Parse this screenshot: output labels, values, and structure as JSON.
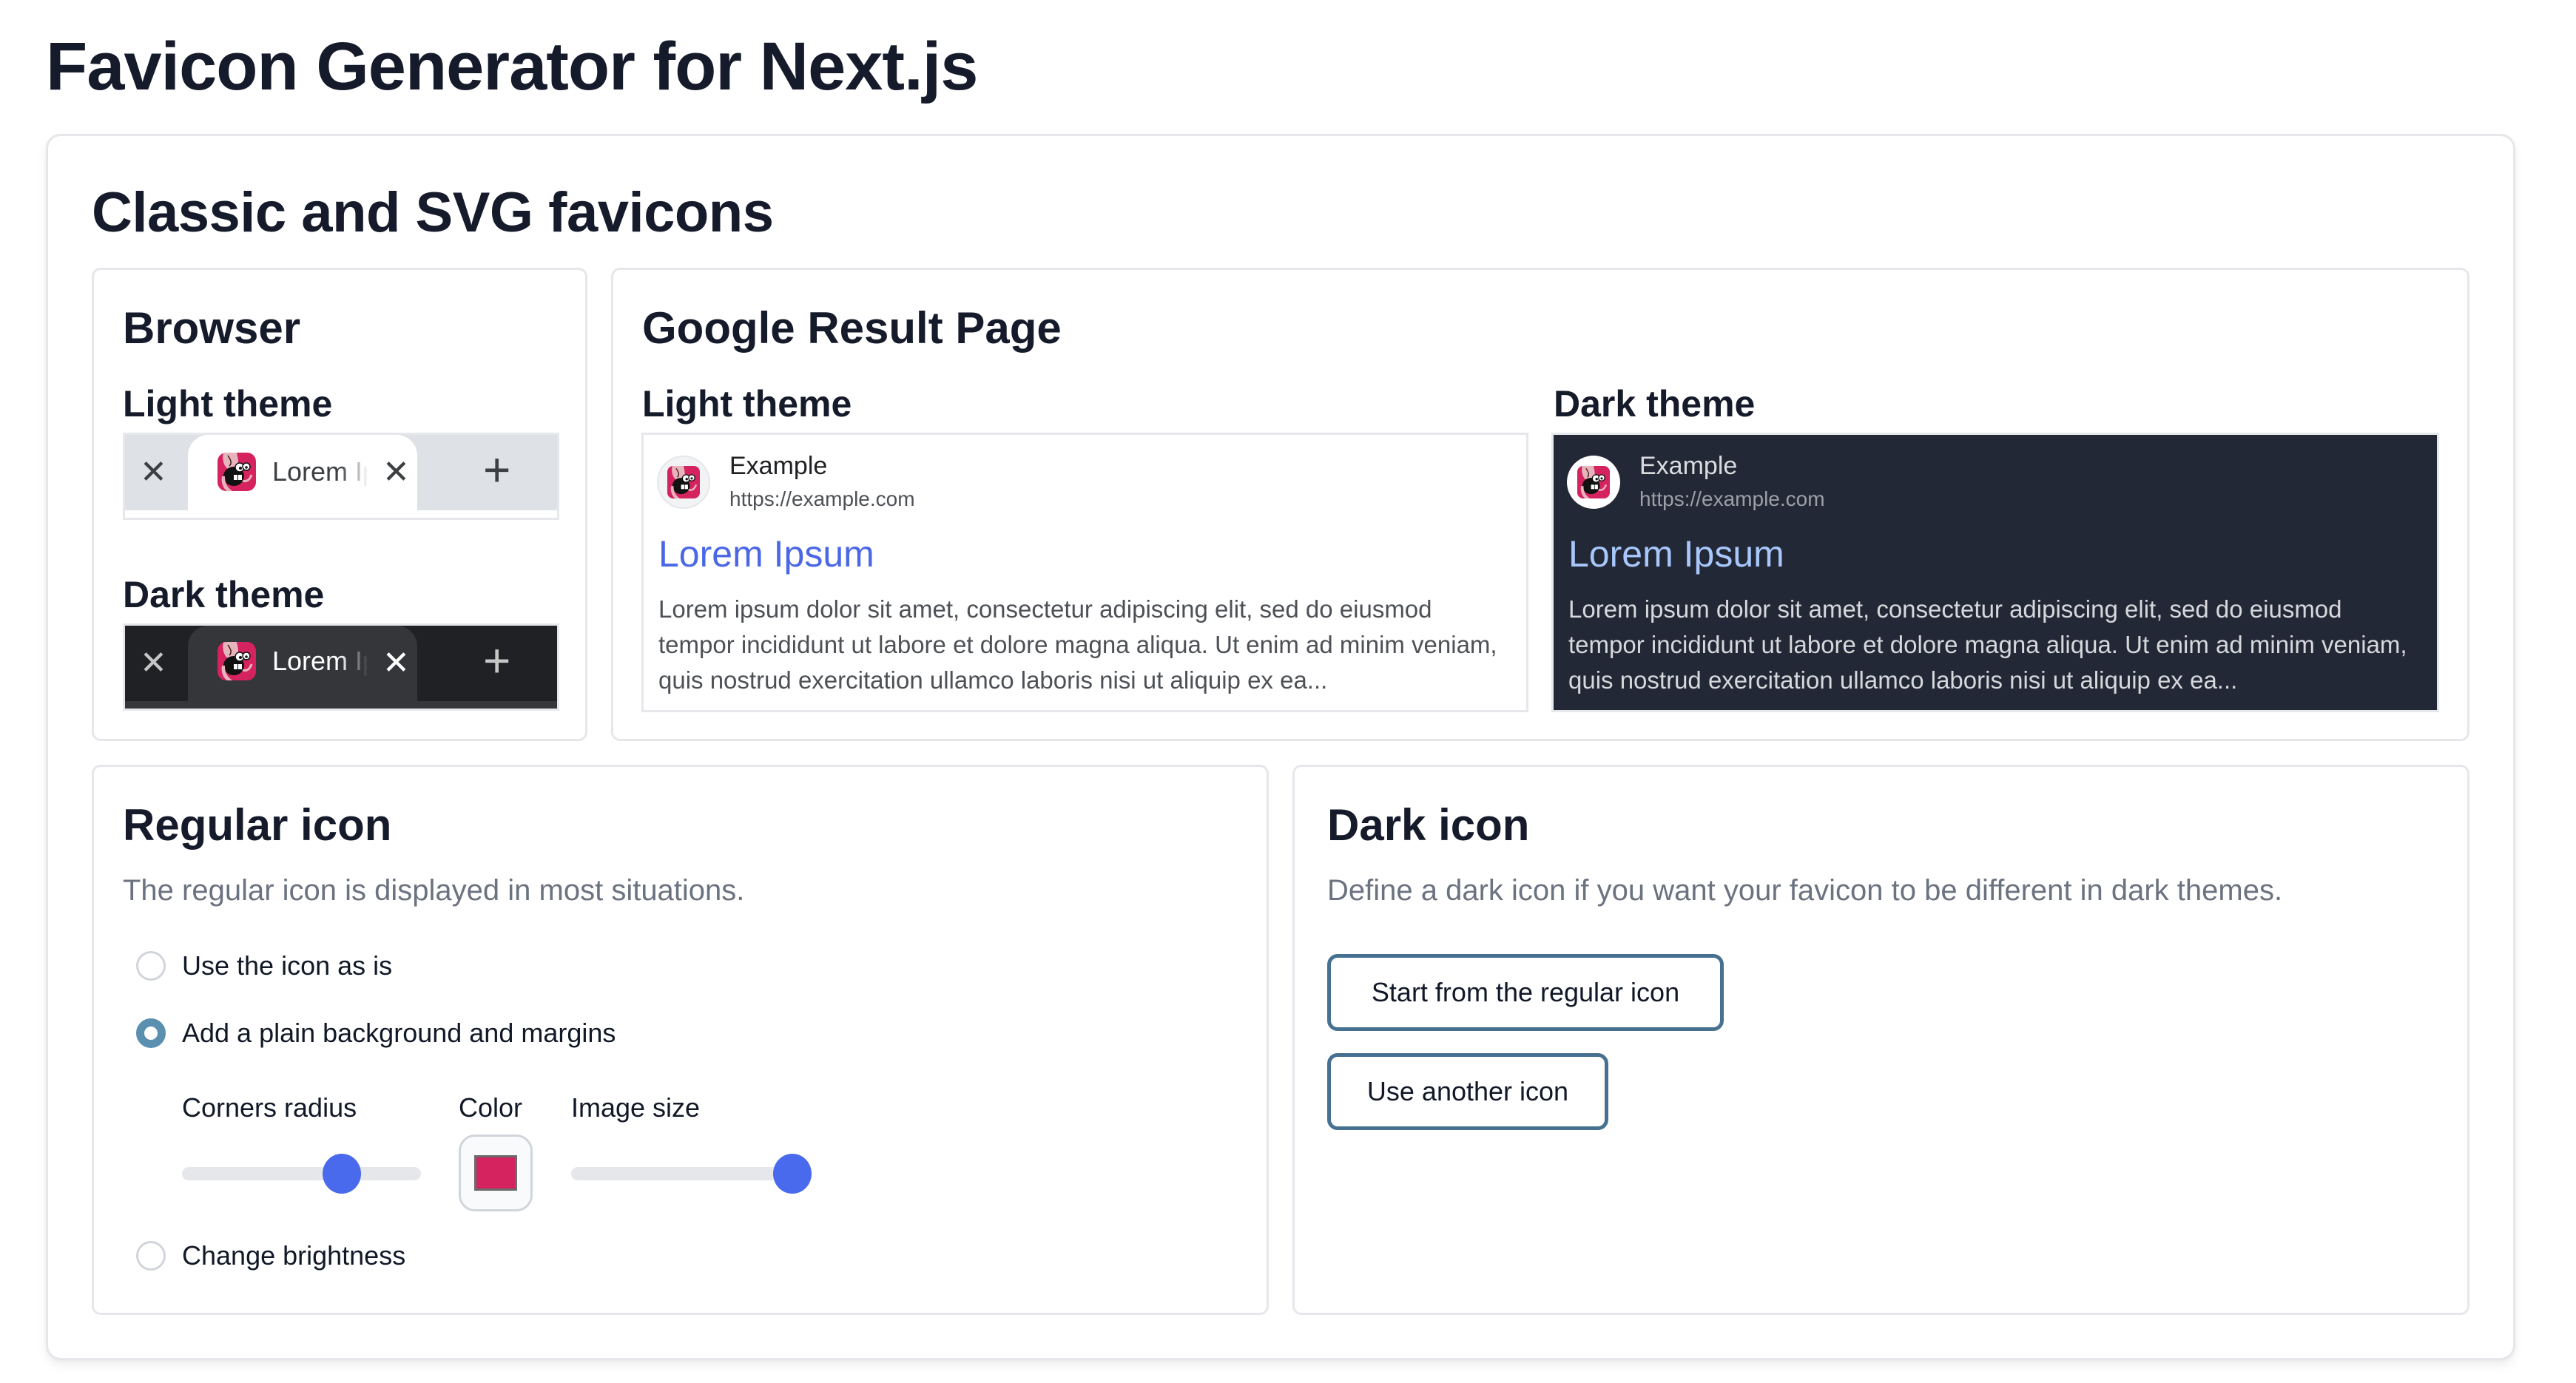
{
  "page": {
    "title": "Favicon Generator for Next.js"
  },
  "classic": {
    "title": "Classic and SVG favicons",
    "browser": {
      "title": "Browser",
      "light": {
        "label": "Light theme",
        "tab_label": "Lorem Ipsum",
        "close_glyph": "✕",
        "new_tab_glyph": "+"
      },
      "dark": {
        "label": "Dark theme",
        "tab_label": "Lorem Ipsum",
        "close_glyph": "✕",
        "new_tab_glyph": "+"
      }
    },
    "google": {
      "title": "Google Result Page",
      "light": {
        "label": "Light theme",
        "site_name": "Example",
        "site_url": "https://example.com",
        "result_title": "Lorem Ipsum",
        "snippet": "Lorem ipsum dolor sit amet, consectetur adipiscing elit, sed do eiusmod tempor incididunt ut labore et dolore magna aliqua. Ut enim ad minim veniam, quis nostrud exercitation ullamco laboris nisi ut aliquip ex ea..."
      },
      "dark": {
        "label": "Dark theme",
        "site_name": "Example",
        "site_url": "https://example.com",
        "result_title": "Lorem Ipsum",
        "snippet": "Lorem ipsum dolor sit amet, consectetur adipiscing elit, sed do eiusmod tempor incididunt ut labore et dolore magna aliqua. Ut enim ad minim veniam, quis nostrud exercitation ullamco laboris nisi ut aliquip ex ea..."
      }
    }
  },
  "regular_icon": {
    "title": "Regular icon",
    "description": "The regular icon is displayed in most situations.",
    "options": [
      {
        "label": "Use the icon as is",
        "checked": false
      },
      {
        "label": "Add a plain background and margins",
        "checked": true
      },
      {
        "label": "Change brightness",
        "checked": false
      }
    ],
    "corners_radius": {
      "label": "Corners radius",
      "value_fraction": 0.67
    },
    "color": {
      "label": "Color",
      "value": "#d4235f"
    },
    "image_size": {
      "label": "Image size",
      "value_fraction": 0.93
    }
  },
  "dark_icon": {
    "title": "Dark icon",
    "description": "Define a dark icon if you want your favicon to be different in dark themes.",
    "buttons": {
      "start_from_regular": "Start from the regular icon",
      "use_another": "Use another icon"
    }
  },
  "colors": {
    "radio_accent": "#5b8fb0",
    "slider_accent": "#4a6aed",
    "button_border": "#477190",
    "favicon_brand": "#d4235f",
    "google_link_light": "#4a67e6",
    "google_link_dark": "#a8c7fa"
  }
}
